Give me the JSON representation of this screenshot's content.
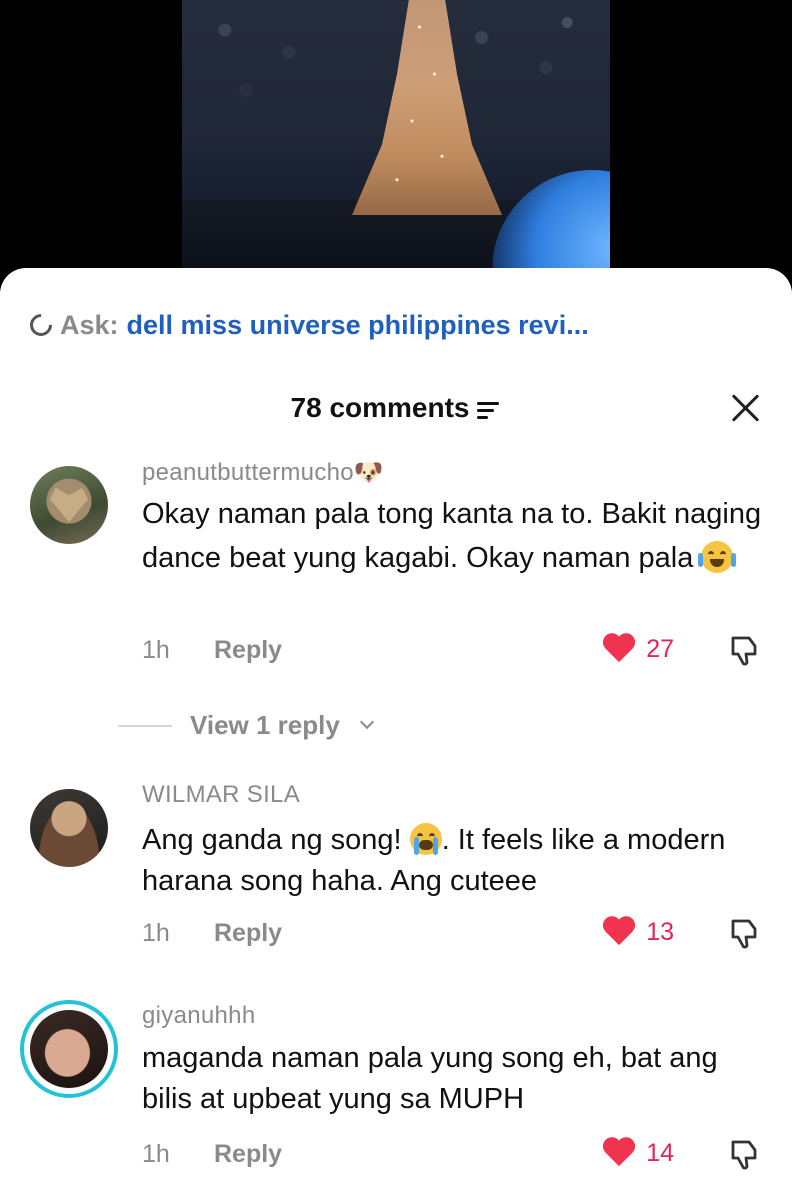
{
  "ask": {
    "label": "Ask:",
    "query": "dell miss universe philippines revi..."
  },
  "header": {
    "comments_count": "78 comments"
  },
  "comments": [
    {
      "username": "peanutbuttermucho🐶",
      "text": "Okay naman pala tong kanta na to. Bakit naging dance beat yung kagabi. Okay naman pala",
      "emoji": "laugh-cry-emoji",
      "time": "1h",
      "reply_label": "Reply",
      "likes": "27",
      "view_replies": "View 1 reply"
    },
    {
      "username": "WILMAR SILA",
      "text_before": "Ang ganda ng song!",
      "text_after": ". It feels like a modern harana song haha. Ang cuteee",
      "emoji": "crying-emoji",
      "time": "1h",
      "reply_label": "Reply",
      "likes": "13"
    },
    {
      "username": "giyanuhhh",
      "text": "maganda naman pala yung song eh, bat ang bilis at upbeat yung sa MUPH",
      "time": "1h",
      "reply_label": "Reply",
      "likes": "14"
    }
  ],
  "colors": {
    "link_blue": "#1f5fbf",
    "like_red": "#e2245c",
    "story_ring": "#22c3d6"
  }
}
